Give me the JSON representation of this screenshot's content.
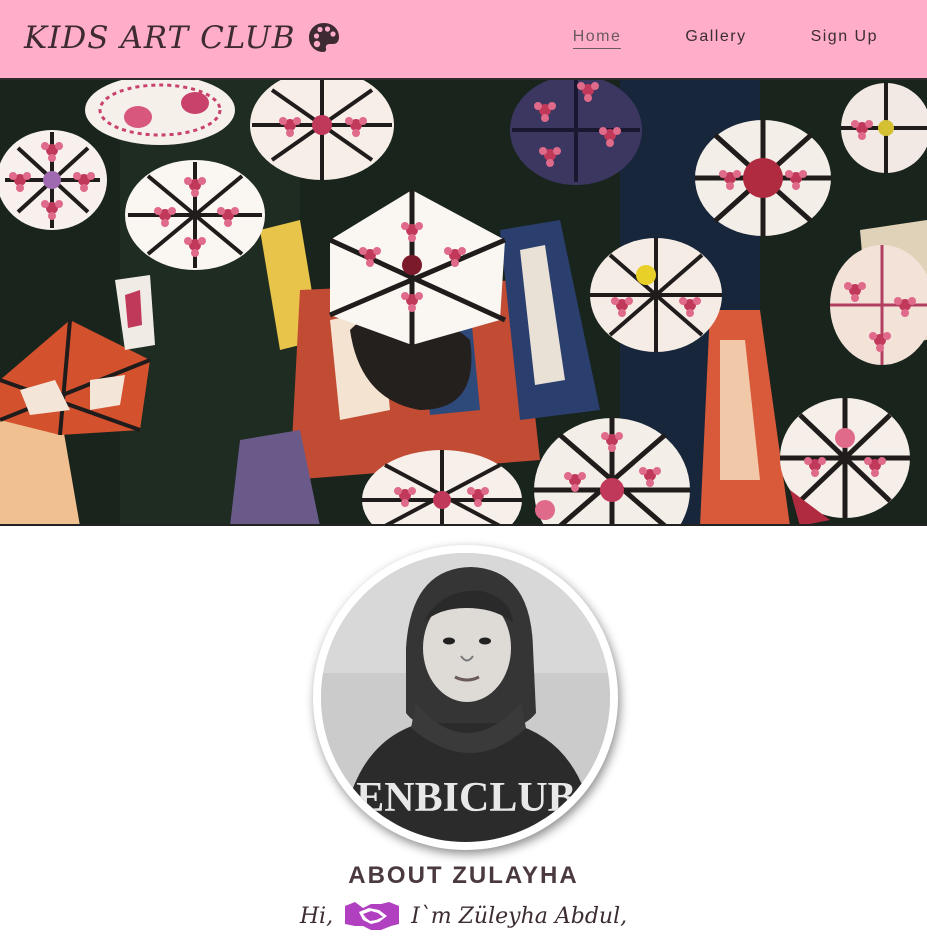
{
  "header": {
    "brand_text": "KIDS ART CLUB",
    "brand_icon": "palette-icon",
    "background": "#ffadc9",
    "nav": [
      {
        "label": "Home",
        "active": true
      },
      {
        "label": "Gallery",
        "active": false
      },
      {
        "label": "Sign Up",
        "active": false
      }
    ]
  },
  "hero": {
    "image": "painting of embroidered skullcaps (doppi)"
  },
  "about": {
    "title": "ABOUT ZULAYHA",
    "greeting_hi": "Hi,",
    "greeting_icon": "handshake-icon",
    "greeting_icon_color": "#b040c0",
    "greeting_rest": "I`m Züleyha Abdul,"
  },
  "profile": {
    "shirt_text": "ENBICLUB"
  }
}
